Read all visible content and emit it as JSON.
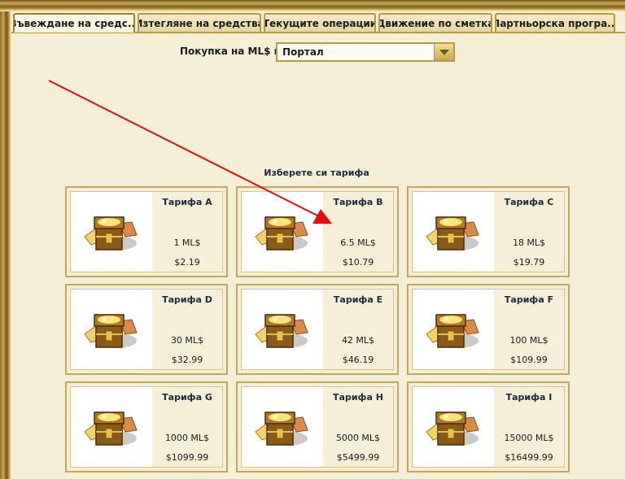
{
  "tabs": [
    {
      "label": "Въвеждане на средс...",
      "active": true
    },
    {
      "label": "Изтегляне на средства",
      "active": false
    },
    {
      "label": "Текущите операции",
      "active": false
    },
    {
      "label": "Движение по сметка",
      "active": false
    },
    {
      "label": "Партньорска програ...",
      "active": false
    }
  ],
  "purchase": {
    "label": "Покупка на ML$ в:",
    "selected": "Портал"
  },
  "choose_heading": "Изберете си тарифа",
  "tariffs": [
    {
      "name": "Тарифа A",
      "ml": "1 ML$",
      "price": "$2.19"
    },
    {
      "name": "Тарифа B",
      "ml": "6.5 ML$",
      "price": "$10.79"
    },
    {
      "name": "Тарифа C",
      "ml": "18 ML$",
      "price": "$19.79"
    },
    {
      "name": "Тарифа D",
      "ml": "30 ML$",
      "price": "$32.99"
    },
    {
      "name": "Тарифа E",
      "ml": "42 ML$",
      "price": "$46.19"
    },
    {
      "name": "Тарифа F",
      "ml": "100 ML$",
      "price": "$109.99"
    },
    {
      "name": "Тарифа G",
      "ml": "1000 ML$",
      "price": "$1099.99"
    },
    {
      "name": "Тарифа H",
      "ml": "5000 ML$",
      "price": "$5499.99"
    },
    {
      "name": "Тарифа I",
      "ml": "15000 ML$",
      "price": "$16499.99"
    }
  ],
  "colors": {
    "background": "#f4efd6",
    "border_gold": "#c4a75a",
    "annotation_arrow": "#e01010"
  }
}
